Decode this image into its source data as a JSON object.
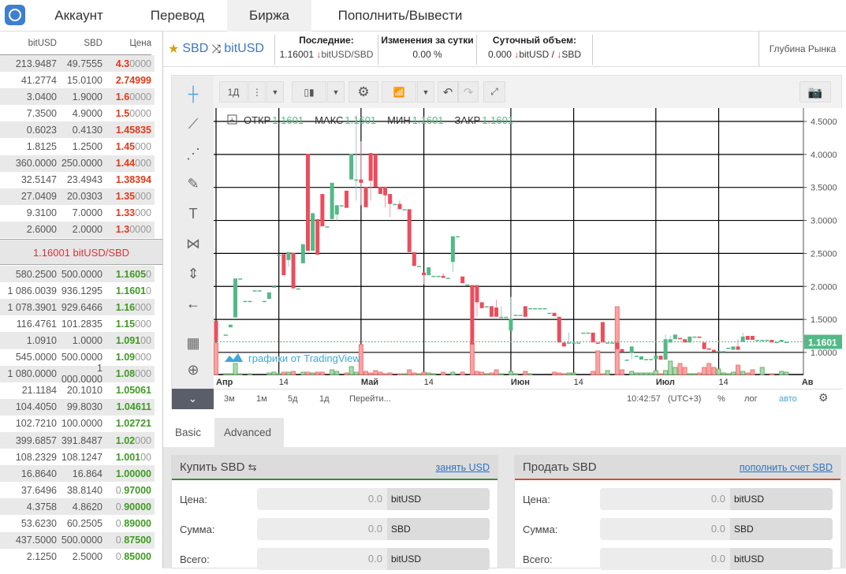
{
  "nav": {
    "tabs": [
      {
        "label": "Аккаунт"
      },
      {
        "label": "Перевод"
      },
      {
        "label": "Биржа",
        "active": true
      },
      {
        "label": "Пополнить/Вывести"
      }
    ]
  },
  "book": {
    "headers": [
      "bitUSD",
      "SBD",
      "Цена"
    ],
    "asks": [
      [
        "213.9487",
        "49.7555",
        "4.3",
        "0000"
      ],
      [
        "41.2774",
        "15.0100",
        "2.74999",
        ""
      ],
      [
        "3.0400",
        "1.9000",
        "1.6",
        "0000"
      ],
      [
        "7.3500",
        "4.9000",
        "1.5",
        "0000"
      ],
      [
        "0.6023",
        "0.4130",
        "1.45835",
        ""
      ],
      [
        "1.8125",
        "1.2500",
        "1.45",
        "000"
      ],
      [
        "360.0000",
        "250.0000",
        "1.44",
        "000"
      ],
      [
        "32.5147",
        "23.4943",
        "1.38394",
        ""
      ],
      [
        "27.0409",
        "20.0303",
        "1.35",
        "000"
      ],
      [
        "9.3100",
        "7.0000",
        "1.33",
        "000"
      ],
      [
        "2.6000",
        "2.0000",
        "1.3",
        "0000"
      ]
    ],
    "mid": "1.16001 bitUSD/SBD",
    "bids": [
      [
        "580.2500",
        "500.0000",
        "",
        "1.1605",
        "0"
      ],
      [
        "1 086.0039",
        "936.1295",
        "",
        "1.1601",
        "0"
      ],
      [
        "1 078.3901",
        "929.6466",
        "",
        "1.16",
        "000"
      ],
      [
        "116.4761",
        "101.2835",
        "",
        "1.15",
        "000"
      ],
      [
        "1.0910",
        "1.0000",
        "",
        "1.091",
        "00"
      ],
      [
        "545.0000",
        "500.0000",
        "",
        "1.09",
        "000"
      ],
      [
        "1 080.0000",
        "1 000.0000",
        "",
        "1.08",
        "000"
      ],
      [
        "21.1184",
        "20.1010",
        "",
        "1.05061",
        ""
      ],
      [
        "104.4050",
        "99.8030",
        "",
        "1.04611",
        ""
      ],
      [
        "102.7210",
        "100.0000",
        "",
        "1.02721",
        ""
      ],
      [
        "399.6857",
        "391.8487",
        "",
        "1.02",
        "000"
      ],
      [
        "108.2329",
        "108.1247",
        "",
        "1.001",
        "00"
      ],
      [
        "16.8640",
        "16.864",
        "",
        "1.00000",
        ""
      ],
      [
        "37.6496",
        "38.8140",
        "0.",
        "97000",
        ""
      ],
      [
        "4.3758",
        "4.8620",
        "0.",
        "90000",
        ""
      ],
      [
        "53.6230",
        "60.2505",
        "0.",
        "89000",
        ""
      ],
      [
        "437.5000",
        "500.0000",
        "0.",
        "87500",
        ""
      ],
      [
        "2.1250",
        "2.5000",
        "0.",
        "85000",
        ""
      ]
    ]
  },
  "market": {
    "base": "SBD",
    "quote": "bitUSD",
    "last_label": "Последние:",
    "last_value": "1.16001",
    "last_unit": "bitUSD/SBD",
    "change_label": "Изменения за сутки",
    "change_value": "0.00",
    "change_unit": "%",
    "volume_label": "Суточный объем:",
    "volume_value": "0.000",
    "volume_unit1": "bitUSD /",
    "volume_unit2": "SBD",
    "depth": "Глубина Рынка"
  },
  "chart_toolbar": {
    "interval": "1Д"
  },
  "chart_data": {
    "type": "candlestick",
    "legend": {
      "open_label": "ОТКР",
      "open": "1.1601",
      "high_label": "МАКС",
      "high": "1.1601",
      "low_label": "МИН",
      "low": "1.1601",
      "close_label": "ЗАКР",
      "close": "1.1601"
    },
    "watermark": "графики от TradingView",
    "last_price": "1.1601",
    "y_ticks": [
      "4.5000",
      "4.0000",
      "3.5000",
      "3.0000",
      "2.5000",
      "2.0000",
      "1.5000",
      "1.0000"
    ],
    "ylim": [
      0.6,
      4.7
    ],
    "x_ticks": [
      {
        "label": "Апр",
        "date": "04-01"
      },
      {
        "label": "14",
        "date": "04-14"
      },
      {
        "label": "Май",
        "date": "05-01"
      },
      {
        "label": "14",
        "date": "05-14"
      },
      {
        "label": "Июн",
        "date": "06-01"
      },
      {
        "label": "14",
        "date": "06-14"
      },
      {
        "label": "Июл",
        "date": "07-01"
      },
      {
        "label": "14",
        "date": "07-14"
      },
      {
        "label": "Ав",
        "date": "08-01"
      }
    ],
    "colors": {
      "up": "#53b987",
      "down": "#eb4d5c",
      "up_volume": "#a9dcb0",
      "down_volume": "#f9a3a3"
    },
    "candles_fields": [
      "date",
      "open",
      "high",
      "low",
      "close",
      "volume"
    ],
    "candles": [
      [
        "04-01",
        1.48,
        1.48,
        1.17,
        1.17,
        40
      ],
      [
        "04-03",
        1.27,
        1.27,
        1.27,
        1.27,
        1
      ],
      [
        "04-04",
        1.38,
        1.42,
        1.38,
        1.42,
        1
      ],
      [
        "04-05",
        1.53,
        2.12,
        1.53,
        2.12,
        14
      ],
      [
        "04-06",
        2.12,
        2.12,
        2.12,
        2.12,
        1
      ],
      [
        "04-07",
        1.78,
        1.78,
        1.78,
        1.78,
        0
      ],
      [
        "04-08",
        1.78,
        1.78,
        1.78,
        1.78,
        1
      ],
      [
        "04-09",
        1.94,
        1.94,
        1.94,
        1.94,
        0
      ],
      [
        "04-10",
        1.94,
        1.94,
        1.94,
        1.94,
        0
      ],
      [
        "04-11",
        1.78,
        1.78,
        1.78,
        1.78,
        0
      ],
      [
        "04-12",
        1.81,
        1.91,
        1.81,
        1.91,
        2
      ],
      [
        "04-13",
        2.0,
        2.0,
        2.0,
        2.0,
        3
      ],
      [
        "04-14",
        2.48,
        2.48,
        2.48,
        2.48,
        1
      ],
      [
        "04-15",
        2.49,
        2.49,
        2.17,
        2.17,
        3
      ],
      [
        "04-16",
        2.4,
        2.52,
        2.3,
        2.52,
        3
      ],
      [
        "04-17",
        2.51,
        2.51,
        1.97,
        1.97,
        4
      ],
      [
        "04-18",
        1.97,
        1.97,
        1.97,
        1.97,
        0
      ],
      [
        "04-19",
        2.35,
        2.64,
        2.35,
        2.64,
        3
      ],
      [
        "04-20",
        4.01,
        4.01,
        2.54,
        2.54,
        3
      ],
      [
        "04-21",
        2.54,
        3.11,
        2.54,
        3.11,
        2
      ],
      [
        "04-22",
        3.02,
        3.02,
        2.48,
        2.48,
        3
      ],
      [
        "04-23",
        3.4,
        3.4,
        2.91,
        2.91,
        3
      ],
      [
        "04-24",
        2.91,
        2.91,
        2.91,
        2.91,
        0
      ],
      [
        "04-25",
        3.02,
        3.57,
        3.02,
        3.57,
        6
      ],
      [
        "04-26",
        3.09,
        3.23,
        3.0,
        3.23,
        4
      ],
      [
        "04-27",
        3.23,
        3.23,
        3.23,
        3.23,
        0
      ],
      [
        "04-28",
        3.45,
        3.45,
        3.19,
        3.19,
        2
      ],
      [
        "04-29",
        3.62,
        4.01,
        3.62,
        4.01,
        10
      ],
      [
        "04-30",
        3.62,
        4.6,
        3.3,
        3.62,
        3
      ],
      [
        "05-01",
        3.62,
        4.2,
        3.23,
        3.57,
        38
      ],
      [
        "05-02",
        3.51,
        3.51,
        3.2,
        3.2,
        4
      ],
      [
        "05-03",
        4.02,
        4.02,
        3.3,
        3.6,
        2
      ],
      [
        "05-04",
        4.0,
        4.0,
        3.51,
        3.51,
        5
      ],
      [
        "05-05",
        3.51,
        3.51,
        3.4,
        3.4,
        3
      ],
      [
        "05-06",
        3.51,
        3.51,
        3.2,
        3.38,
        1
      ],
      [
        "05-07",
        3.4,
        3.4,
        3.05,
        3.25,
        2
      ],
      [
        "05-08",
        3.25,
        3.25,
        3.25,
        3.25,
        0
      ],
      [
        "05-09",
        3.25,
        3.3,
        3.17,
        3.17,
        1
      ],
      [
        "05-10",
        3.17,
        3.17,
        3.17,
        3.17,
        1
      ],
      [
        "05-11",
        3.17,
        3.17,
        2.52,
        2.52,
        6
      ],
      [
        "05-12",
        2.52,
        2.52,
        2.31,
        2.31,
        2
      ],
      [
        "05-13",
        2.31,
        2.31,
        2.31,
        2.31,
        1
      ],
      [
        "05-14",
        2.21,
        2.21,
        2.03,
        2.17,
        3
      ],
      [
        "05-15",
        2.17,
        2.29,
        2.17,
        2.29,
        2
      ],
      [
        "05-16",
        2.16,
        2.16,
        2.16,
        2.16,
        1
      ],
      [
        "05-17",
        2.16,
        2.16,
        2.16,
        2.16,
        0
      ],
      [
        "05-18",
        2.16,
        2.2,
        2.13,
        2.13,
        3
      ],
      [
        "05-19",
        2.13,
        2.13,
        2.13,
        2.13,
        0
      ],
      [
        "05-20",
        2.37,
        2.76,
        2.22,
        2.76,
        3
      ],
      [
        "05-21",
        2.76,
        2.76,
        2.76,
        2.76,
        0
      ],
      [
        "05-22",
        2.15,
        2.15,
        2.05,
        2.05,
        3
      ],
      [
        "05-23",
        2.03,
        2.03,
        2.03,
        2.03,
        0
      ],
      [
        "05-24",
        2.02,
        2.02,
        1.12,
        1.12,
        40
      ],
      [
        "05-25",
        2.02,
        2.02,
        1.55,
        1.76,
        4
      ],
      [
        "05-26",
        1.76,
        1.76,
        1.67,
        1.67,
        3
      ],
      [
        "05-27",
        1.7,
        1.7,
        1.7,
        1.7,
        1
      ],
      [
        "05-28",
        1.7,
        1.7,
        1.54,
        1.54,
        2
      ],
      [
        "05-29",
        1.68,
        1.8,
        1.54,
        1.54,
        6
      ],
      [
        "05-30",
        1.54,
        1.7,
        1.54,
        1.54,
        1
      ],
      [
        "05-31",
        1.54,
        1.54,
        1.54,
        1.54,
        0
      ],
      [
        "06-01",
        1.33,
        1.84,
        1.33,
        1.51,
        4
      ],
      [
        "06-02",
        1.57,
        1.57,
        1.57,
        1.57,
        1
      ],
      [
        "06-03",
        1.57,
        1.57,
        1.57,
        1.57,
        0
      ],
      [
        "06-04",
        1.7,
        1.7,
        1.54,
        1.54,
        4
      ],
      [
        "06-05",
        1.67,
        1.67,
        1.67,
        1.67,
        1
      ],
      [
        "06-06",
        1.67,
        1.67,
        1.67,
        1.67,
        0
      ],
      [
        "06-07",
        1.67,
        1.67,
        1.67,
        1.67,
        0
      ],
      [
        "06-08",
        1.67,
        1.67,
        1.67,
        1.67,
        0
      ],
      [
        "06-09",
        1.6,
        1.6,
        1.6,
        1.6,
        0
      ],
      [
        "06-10",
        1.6,
        1.6,
        1.55,
        1.55,
        3
      ],
      [
        "06-11",
        1.54,
        1.54,
        1.15,
        1.15,
        2
      ],
      [
        "06-12",
        1.15,
        1.15,
        1.09,
        1.09,
        1
      ],
      [
        "06-13",
        1.15,
        1.3,
        1.15,
        1.15,
        2
      ],
      [
        "06-14",
        1.15,
        1.15,
        1.15,
        1.15,
        2
      ],
      [
        "06-15",
        1.15,
        1.15,
        1.15,
        1.15,
        0
      ],
      [
        "06-16",
        1.3,
        1.3,
        1.3,
        1.3,
        0
      ],
      [
        "06-17",
        1.3,
        1.3,
        1.3,
        1.3,
        0
      ],
      [
        "06-18",
        1.3,
        1.3,
        1.15,
        1.15,
        4
      ],
      [
        "06-19",
        1.15,
        1.15,
        1.13,
        1.13,
        30
      ],
      [
        "06-20",
        1.46,
        1.46,
        1.15,
        1.15,
        1
      ],
      [
        "06-21",
        1.15,
        1.15,
        1.15,
        1.15,
        5
      ],
      [
        "06-22",
        1.15,
        1.15,
        1.15,
        1.15,
        0
      ],
      [
        "06-23",
        1.15,
        1.15,
        1.05,
        1.05,
        86
      ],
      [
        "06-24",
        1.05,
        1.05,
        1.01,
        1.01,
        6
      ],
      [
        "06-25",
        0.89,
        0.89,
        0.89,
        0.89,
        0
      ],
      [
        "06-26",
        0.99,
        1.09,
        0.9,
        1.09,
        4
      ],
      [
        "06-27",
        0.95,
        0.95,
        0.95,
        0.95,
        2
      ],
      [
        "06-28",
        0.89,
        0.94,
        0.89,
        0.94,
        2
      ],
      [
        "06-29",
        0.9,
        0.9,
        0.9,
        0.9,
        2
      ],
      [
        "06-30",
        0.9,
        0.9,
        0.9,
        0.9,
        2
      ],
      [
        "07-01",
        0.9,
        0.95,
        0.9,
        0.95,
        5
      ],
      [
        "07-02",
        0.95,
        0.95,
        0.89,
        0.89,
        1
      ],
      [
        "07-03",
        0.89,
        1.27,
        0.89,
        1.2,
        5
      ],
      [
        "07-04",
        1.15,
        1.25,
        1.15,
        1.2,
        17
      ],
      [
        "07-05",
        1.2,
        1.27,
        1.2,
        1.27,
        9
      ],
      [
        "07-06",
        1.22,
        1.22,
        1.2,
        1.2,
        14
      ],
      [
        "07-07",
        1.2,
        1.2,
        1.15,
        1.15,
        9
      ],
      [
        "07-08",
        1.15,
        1.24,
        1.15,
        1.24,
        1
      ],
      [
        "07-09",
        1.24,
        1.24,
        1.24,
        1.24,
        1
      ],
      [
        "07-10",
        1.24,
        1.24,
        1.22,
        1.22,
        2
      ],
      [
        "07-11",
        1.15,
        1.15,
        1.05,
        1.05,
        9
      ],
      [
        "07-12",
        1.06,
        1.06,
        1.04,
        1.04,
        14
      ],
      [
        "07-13",
        1.04,
        1.04,
        1.01,
        1.01,
        9
      ],
      [
        "07-14",
        1.02,
        1.02,
        1.02,
        1.02,
        7
      ],
      [
        "07-15",
        1.02,
        1.02,
        1.02,
        1.02,
        2
      ],
      [
        "07-16",
        1.07,
        1.07,
        1.07,
        1.07,
        1
      ],
      [
        "07-17",
        1.04,
        1.09,
        1.04,
        1.09,
        3
      ],
      [
        "07-18",
        1.09,
        1.2,
        1.04,
        1.04,
        12
      ],
      [
        "07-19",
        1.16,
        1.3,
        1.16,
        1.24,
        4
      ],
      [
        "07-20",
        1.25,
        1.25,
        1.19,
        1.19,
        2
      ],
      [
        "07-21",
        1.25,
        1.25,
        1.19,
        1.19,
        6
      ],
      [
        "07-22",
        1.19,
        1.19,
        1.19,
        1.19,
        0
      ],
      [
        "07-23",
        1.19,
        1.19,
        1.19,
        1.19,
        9
      ],
      [
        "07-24",
        1.19,
        1.19,
        1.19,
        1.19,
        0
      ],
      [
        "07-25",
        1.19,
        1.19,
        1.15,
        1.15,
        1
      ],
      [
        "07-26",
        1.16,
        1.16,
        1.16,
        1.16,
        0
      ],
      [
        "07-27",
        1.16,
        1.19,
        1.16,
        1.19,
        4
      ],
      [
        "07-28",
        1.16,
        1.16,
        1.16,
        1.16,
        3
      ]
    ]
  },
  "chart_bottom": {
    "ranges": [
      "3м",
      "1м",
      "5д",
      "1д"
    ],
    "goto": "Перейти...",
    "time": "10:42:57",
    "tz": "(UTC+3)",
    "percent": "%",
    "log": "лог",
    "auto": "авто"
  },
  "form_tabs": [
    {
      "label": "Basic"
    },
    {
      "label": "Advanced",
      "active": true
    }
  ],
  "buy": {
    "title": "Купить SBD",
    "swap": "⇆",
    "link": "занять USD",
    "fields": [
      {
        "label": "Цена:",
        "value": "0.0",
        "unit": "bitUSD"
      },
      {
        "label": "Сумма:",
        "value": "0.0",
        "unit": "SBD"
      },
      {
        "label": "Всего:",
        "value": "0.0",
        "unit": "bitUSD"
      }
    ],
    "accent": "#3a8a3a"
  },
  "sell": {
    "title": "Продать SBD",
    "link": "пополнить счет SBD",
    "fields": [
      {
        "label": "Цена:",
        "value": "0.0",
        "unit": "bitUSD"
      },
      {
        "label": "Сумма:",
        "value": "0.0",
        "unit": "SBD"
      },
      {
        "label": "Всего:",
        "value": "0.0",
        "unit": "bitUSD"
      }
    ],
    "accent": "#d0502a"
  }
}
